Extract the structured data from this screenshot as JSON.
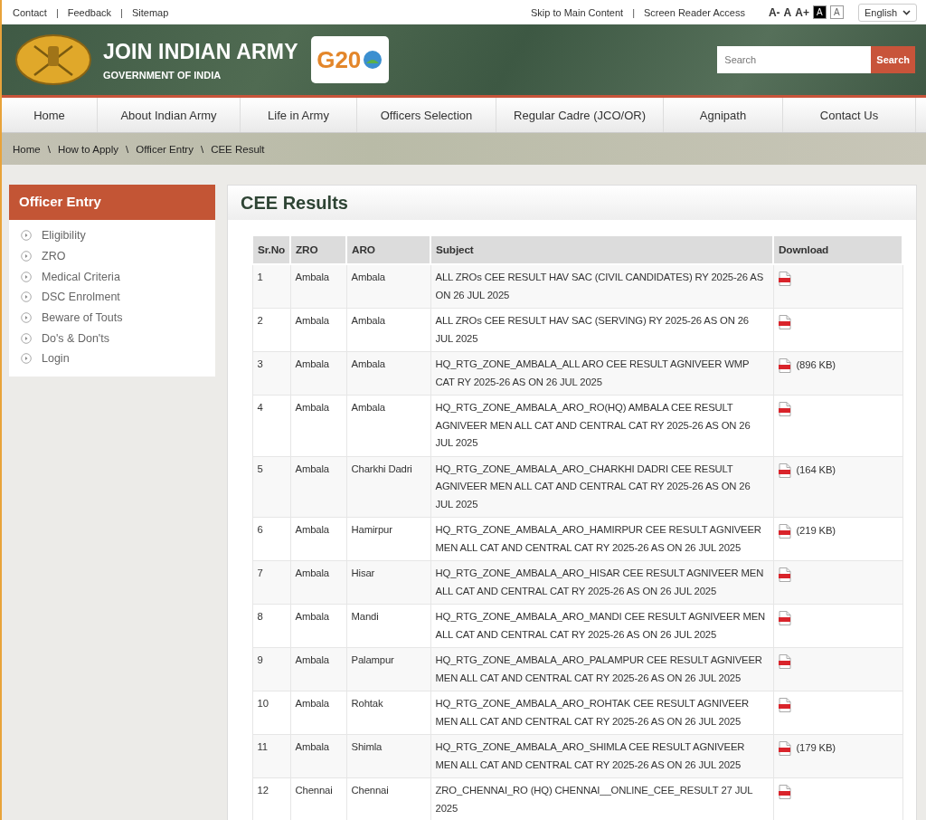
{
  "top_bar": {
    "links": [
      "Contact",
      "Feedback",
      "Sitemap"
    ],
    "access_links": [
      "Skip to Main Content",
      "Screen Reader Access"
    ],
    "font_sizes": [
      "A-",
      "A",
      "A+"
    ],
    "contrast": [
      {
        "label": "A",
        "kind": "dark"
      },
      {
        "label": "A",
        "kind": "light"
      }
    ],
    "language": "English",
    "separator": "|"
  },
  "header": {
    "title": "JOIN INDIAN ARMY",
    "subtitle": "GOVERNMENT OF INDIA",
    "logo_text": "G20",
    "search": {
      "placeholder": "Search",
      "button": "Search"
    }
  },
  "nav": [
    "Home",
    "About Indian Army",
    "Life in Army",
    "Officers Selection",
    "Regular Cadre (JCO/OR)",
    "Agnipath",
    "Contact Us"
  ],
  "breadcrumb": {
    "separator": "\\",
    "items": [
      "Home",
      "How to Apply",
      "Officer Entry",
      "CEE Result"
    ]
  },
  "sidebar": {
    "title": "Officer Entry",
    "items": [
      "Eligibility",
      "ZRO",
      "Medical Criteria",
      "DSC Enrolment",
      "Beware of Touts",
      "Do's & Don'ts",
      "Login"
    ]
  },
  "content": {
    "title": "CEE Results",
    "table": {
      "columns": [
        "Sr.No",
        "ZRO",
        "ARO",
        "Subject",
        "Download"
      ],
      "rows": [
        {
          "sr": "1",
          "zro": "Ambala",
          "aro": "Ambala",
          "subject": "ALL ZROs CEE RESULT HAV SAC (CIVIL CANDIDATES) RY 2025-26 AS ON 26 JUL 2025"
        },
        {
          "sr": "2",
          "zro": "Ambala",
          "aro": "Ambala",
          "subject": "ALL ZROs CEE RESULT HAV SAC (SERVING) RY 2025-26 AS ON 26 JUL 2025"
        },
        {
          "sr": "3",
          "zro": "Ambala",
          "aro": "Ambala",
          "subject": "HQ_RTG_ZONE_AMBALA_ALL ARO CEE RESULT AGNIVEER WMP CAT RY 2025-26 AS ON 26 JUL 2025",
          "size": "(896 KB)"
        },
        {
          "sr": "4",
          "zro": "Ambala",
          "aro": "Ambala",
          "subject": "HQ_RTG_ZONE_AMBALA_ARO_RO(HQ) AMBALA CEE RESULT AGNIVEER MEN ALL CAT AND CENTRAL CAT RY 2025-26 AS ON 26 JUL 2025"
        },
        {
          "sr": "5",
          "zro": "Ambala",
          "aro": "Charkhi Dadri",
          "subject": "HQ_RTG_ZONE_AMBALA_ARO_CHARKHI DADRI CEE RESULT AGNIVEER MEN ALL CAT AND CENTRAL CAT RY 2025-26 AS ON 26 JUL 2025",
          "size": "(164 KB)"
        },
        {
          "sr": "6",
          "zro": "Ambala",
          "aro": "Hamirpur",
          "subject": "HQ_RTG_ZONE_AMBALA_ARO_HAMIRPUR CEE RESULT AGNIVEER MEN ALL CAT AND CENTRAL CAT RY 2025-26 AS ON 26 JUL 2025",
          "size": "(219 KB)"
        },
        {
          "sr": "7",
          "zro": "Ambala",
          "aro": "Hisar",
          "subject": "HQ_RTG_ZONE_AMBALA_ARO_HISAR CEE RESULT AGNIVEER MEN ALL CAT AND CENTRAL CAT RY 2025-26 AS ON 26 JUL 2025"
        },
        {
          "sr": "8",
          "zro": "Ambala",
          "aro": "Mandi",
          "subject": "HQ_RTG_ZONE_AMBALA_ARO_MANDI CEE RESULT AGNIVEER MEN ALL CAT AND CENTRAL CAT RY 2025-26 AS ON 26 JUL 2025"
        },
        {
          "sr": "9",
          "zro": "Ambala",
          "aro": "Palampur",
          "subject": "HQ_RTG_ZONE_AMBALA_ARO_PALAMPUR CEE RESULT AGNIVEER MEN ALL CAT AND CENTRAL CAT RY 2025-26 AS ON 26 JUL 2025"
        },
        {
          "sr": "10",
          "zro": "Ambala",
          "aro": "Rohtak",
          "subject": "HQ_RTG_ZONE_AMBALA_ARO_ROHTAK CEE RESULT AGNIVEER MEN ALL CAT AND CENTRAL CAT RY 2025-26 AS ON 26 JUL 2025"
        },
        {
          "sr": "11",
          "zro": "Ambala",
          "aro": "Shimla",
          "subject": "HQ_RTG_ZONE_AMBALA_ARO_SHIMLA CEE RESULT AGNIVEER MEN ALL CAT AND CENTRAL CAT RY 2025-26 AS ON 26 JUL 2025",
          "size": "(179 KB)"
        },
        {
          "sr": "12",
          "zro": "Chennai",
          "aro": "Chennai",
          "subject": "ZRO_CHENNAI_RO (HQ) CHENNAI__ONLINE_CEE_RESULT 27 JUL 2025"
        }
      ]
    }
  }
}
